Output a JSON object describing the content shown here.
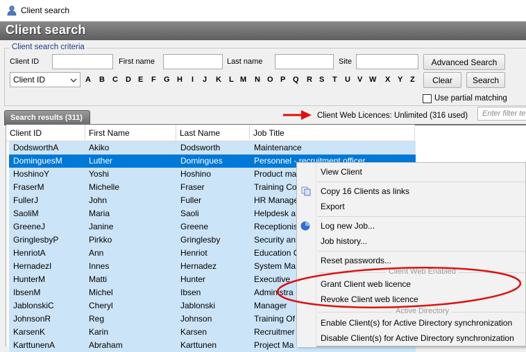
{
  "window": {
    "title": "Client search"
  },
  "banner": {
    "title": "Client search"
  },
  "criteria": {
    "group_title": "Client search criteria",
    "client_id_label": "Client ID",
    "first_name_label": "First name",
    "last_name_label": "Last name",
    "site_label": "Site",
    "client_id_value": "",
    "first_name_value": "",
    "last_name_value": "",
    "site_value": "",
    "field_select_value": "Client ID",
    "letters": [
      "A",
      "B",
      "C",
      "D",
      "E",
      "F",
      "G",
      "H",
      "I",
      "J",
      "K",
      "L",
      "M",
      "N",
      "O",
      "P",
      "Q",
      "R",
      "S",
      "T",
      "U",
      "V",
      "W",
      "X",
      "Y",
      "Z"
    ],
    "advanced_search_label": "Advanced Search",
    "clear_label": "Clear",
    "search_label": "Search",
    "partial_matching_label": "Use partial matching",
    "partial_matching_checked": false
  },
  "results": {
    "tab_label": "Search results (311)",
    "licence_info": "Client Web Licences: Unlimited (316 used)",
    "filter_placeholder": "Enter filter te",
    "columns": [
      "Client ID",
      "First Name",
      "Last Name",
      "Job Title"
    ],
    "rows": [
      [
        "DodsworthA",
        "Akiko",
        "Dodsworth",
        "Maintenance"
      ],
      [
        "DominguesM",
        "Luther",
        "Domingues",
        "Personnel - recruitment officer"
      ],
      [
        "HoshinoY",
        "Yoshi",
        "Hoshino",
        "Product ma"
      ],
      [
        "FraserM",
        "Michelle",
        "Fraser",
        "Training Co"
      ],
      [
        "FullerJ",
        "John",
        "Fuller",
        "HR Manage"
      ],
      [
        "SaoliM",
        "Maria",
        "Saoli",
        "Helpdesk a"
      ],
      [
        "GreeneJ",
        "Janine",
        "Greene",
        "Receptionis"
      ],
      [
        "GringlesbyP",
        "Pirkko",
        "Gringlesby",
        "Security an"
      ],
      [
        "HenriotA",
        "Ann",
        "Henriot",
        "Education C"
      ],
      [
        "HernadezI",
        "Innes",
        "Hernadez",
        "System Ma"
      ],
      [
        "HunterM",
        "Matti",
        "Hunter",
        "Executive"
      ],
      [
        "IbsenM",
        "Michel",
        "Ibsen",
        "Administra"
      ],
      [
        "JablonskiC",
        "Cheryl",
        "Jablonski",
        "Manager"
      ],
      [
        "JohnsonR",
        "Reg",
        "Johnson",
        "Training Of"
      ],
      [
        "KarsenK",
        "Karin",
        "Karsen",
        "Recruitmer"
      ],
      [
        "KarttunenA",
        "Abraham",
        "Karttunen",
        "Project Ma"
      ]
    ],
    "selected_row": 1
  },
  "context_menu": {
    "view_client": "View Client",
    "copy_links": "Copy 16 Clients as links",
    "export": "Export",
    "log_new_job": "Log new Job...",
    "job_history": "Job history...",
    "reset_passwords": "Reset passwords...",
    "client_web_header": "Client Web Enabled",
    "grant_licence": "Grant Client web licence",
    "revoke_licence": "Revoke Client web licence",
    "ad_header": "Active Directory",
    "enable_ad": "Enable Client(s) for Active Directory synchronization",
    "disable_ad": "Disable Client(s) for Active Directory synchronization"
  },
  "colors": {
    "selection_row": "#0078d7",
    "highlight_rows": "#cce4f7",
    "annotation": "#e01010",
    "group_title": "#1a3c86"
  },
  "icons": [
    "user-icon",
    "copy-icon",
    "job-globe-icon",
    "annotation-arrow",
    "annotation-ellipse"
  ]
}
